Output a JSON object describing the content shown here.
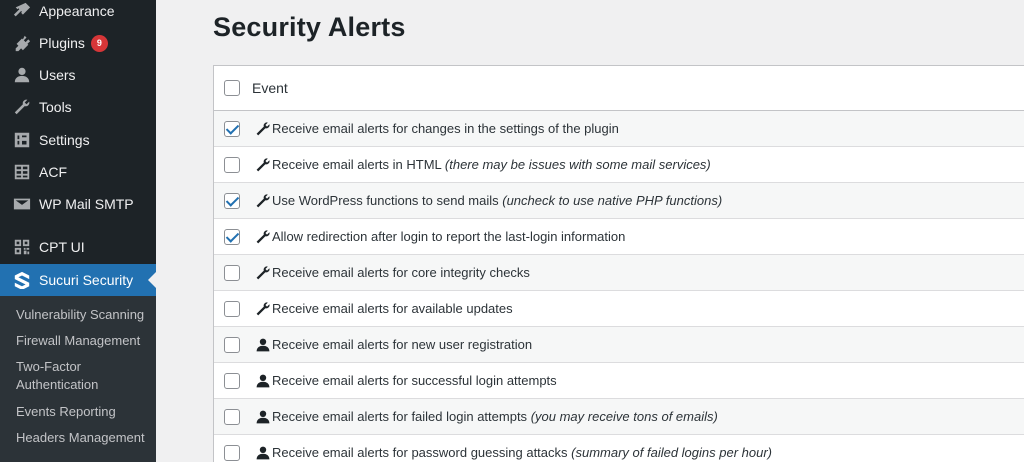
{
  "sidebar": {
    "items": [
      {
        "label": "Appearance",
        "icon": "paintbrush-icon"
      },
      {
        "label": "Plugins",
        "icon": "plugin-icon",
        "badge": "9"
      },
      {
        "label": "Users",
        "icon": "user-icon"
      },
      {
        "label": "Tools",
        "icon": "wrench-icon"
      },
      {
        "label": "Settings",
        "icon": "settings-icon"
      },
      {
        "label": "ACF",
        "icon": "grid-icon"
      },
      {
        "label": "WP Mail SMTP",
        "icon": "mail-icon"
      },
      {
        "label": "CPT UI",
        "icon": "qr-icon"
      },
      {
        "label": "Sucuri Security",
        "icon": "sucuri-icon",
        "active": true
      }
    ],
    "submenu": [
      "Vulnerability Scanning",
      "Firewall Management",
      "Two-Factor Authentication",
      "Events Reporting",
      "Headers Management"
    ]
  },
  "main": {
    "title": "Security Alerts",
    "table": {
      "header": "Event",
      "rows": [
        {
          "text": "Receive email alerts for changes in the settings of the plugin",
          "note": "",
          "checked": true,
          "icon": "wrench-icon"
        },
        {
          "text": "Receive email alerts in HTML ",
          "note": "(there may be issues with some mail services)",
          "checked": false,
          "icon": "wrench-icon"
        },
        {
          "text": "Use WordPress functions to send mails ",
          "note": "(uncheck to use native PHP functions)",
          "checked": true,
          "icon": "wrench-icon"
        },
        {
          "text": "Allow redirection after login to report the last-login information",
          "note": "",
          "checked": true,
          "icon": "wrench-icon"
        },
        {
          "text": "Receive email alerts for core integrity checks",
          "note": "",
          "checked": false,
          "icon": "wrench-icon"
        },
        {
          "text": "Receive email alerts for available updates",
          "note": "",
          "checked": false,
          "icon": "wrench-icon"
        },
        {
          "text": "Receive email alerts for new user registration",
          "note": "",
          "checked": false,
          "icon": "user-icon"
        },
        {
          "text": "Receive email alerts for successful login attempts",
          "note": "",
          "checked": false,
          "icon": "user-icon"
        },
        {
          "text": "Receive email alerts for failed login attempts ",
          "note": "(you may receive tons of emails)",
          "checked": false,
          "icon": "user-icon"
        },
        {
          "text": "Receive email alerts for password guessing attacks ",
          "note": "(summary of failed logins per hour)",
          "checked": false,
          "icon": "user-icon"
        }
      ]
    }
  },
  "colors": {
    "sidebar_bg": "#1d2327",
    "active_bg": "#2271b1",
    "badge_bg": "#d63638",
    "check": "#2271b1"
  }
}
